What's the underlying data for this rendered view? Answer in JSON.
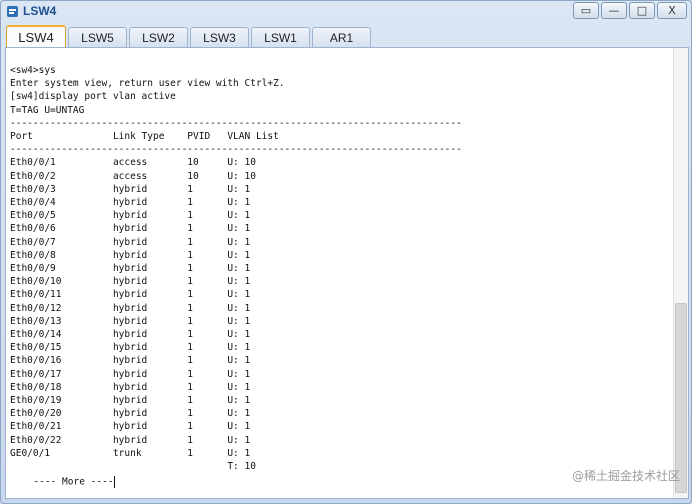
{
  "window": {
    "title": "LSW4",
    "icon": "device-app-icon",
    "buttons": [
      "restore-icon",
      "minimize-icon",
      "maximize-icon",
      "close-icon"
    ],
    "button_glyphs": [
      "▭",
      "—",
      "□",
      "X"
    ]
  },
  "tabs": [
    {
      "label": "LSW4",
      "active": true
    },
    {
      "label": "LSW5",
      "active": false
    },
    {
      "label": "LSW2",
      "active": false
    },
    {
      "label": "LSW3",
      "active": false
    },
    {
      "label": "LSW1",
      "active": false
    },
    {
      "label": "AR1",
      "active": false
    }
  ],
  "terminal": {
    "lines": [
      "<sw4>sys",
      "Enter system view, return user view with Ctrl+Z.",
      "[sw4]display port vlan active",
      "T=TAG U=UNTAG",
      "-------------------------------------------------------------------------------",
      "Port              Link Type    PVID   VLAN List",
      "-------------------------------------------------------------------------------",
      "Eth0/0/1          access       10     U: 10",
      "Eth0/0/2          access       10     U: 10",
      "Eth0/0/3          hybrid       1      U: 1",
      "Eth0/0/4          hybrid       1      U: 1",
      "Eth0/0/5          hybrid       1      U: 1",
      "Eth0/0/6          hybrid       1      U: 1",
      "Eth0/0/7          hybrid       1      U: 1",
      "Eth0/0/8          hybrid       1      U: 1",
      "Eth0/0/9          hybrid       1      U: 1",
      "Eth0/0/10         hybrid       1      U: 1",
      "Eth0/0/11         hybrid       1      U: 1",
      "Eth0/0/12         hybrid       1      U: 1",
      "Eth0/0/13         hybrid       1      U: 1",
      "Eth0/0/14         hybrid       1      U: 1",
      "Eth0/0/15         hybrid       1      U: 1",
      "Eth0/0/16         hybrid       1      U: 1",
      "Eth0/0/17         hybrid       1      U: 1",
      "Eth0/0/18         hybrid       1      U: 1",
      "Eth0/0/19         hybrid       1      U: 1",
      "Eth0/0/20         hybrid       1      U: 1",
      "Eth0/0/21         hybrid       1      U: 1",
      "Eth0/0/22         hybrid       1      U: 1",
      "GE0/0/1           trunk        1      U: 1",
      "                                      T: 10"
    ],
    "more_prompt": "  ---- More ----"
  },
  "watermark": "@稀土掘金技术社区"
}
